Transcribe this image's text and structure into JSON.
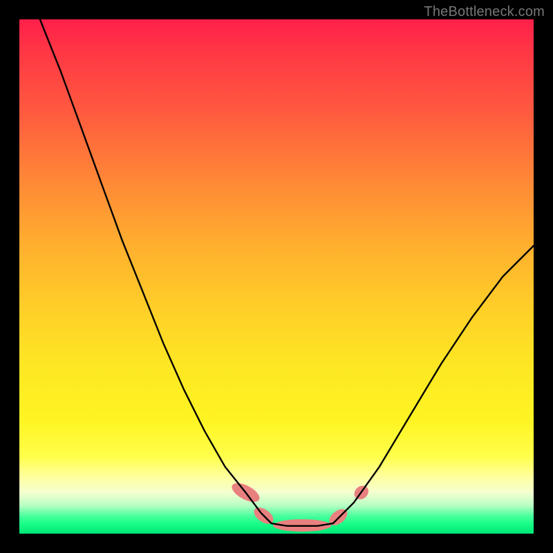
{
  "watermark": "TheBottleneck.com",
  "chart_data": {
    "type": "line",
    "title": "",
    "xlabel": "",
    "ylabel": "",
    "xlim": [
      0,
      100
    ],
    "ylim": [
      0,
      100
    ],
    "series": [
      {
        "name": "left-curve",
        "x": [
          4,
          8,
          12,
          16,
          20,
          24,
          28,
          32,
          36,
          40,
          44,
          47,
          49
        ],
        "y": [
          100,
          90,
          79,
          68,
          57,
          47,
          37,
          28,
          20,
          13,
          8,
          4,
          2
        ]
      },
      {
        "name": "valley-floor",
        "x": [
          49,
          52,
          55,
          58,
          61
        ],
        "y": [
          2,
          1.5,
          1.5,
          1.5,
          2
        ]
      },
      {
        "name": "right-curve",
        "x": [
          61,
          65,
          70,
          76,
          82,
          88,
          94,
          100
        ],
        "y": [
          2,
          6,
          13,
          23,
          33,
          42,
          50,
          56
        ]
      }
    ],
    "markers": [
      {
        "name": "left-cap-upper",
        "x": 44.0,
        "y": 8.0,
        "rx": 10,
        "ry": 22,
        "rot": -62
      },
      {
        "name": "left-cap-lower",
        "x": 47.5,
        "y": 3.5,
        "rx": 9,
        "ry": 16,
        "rot": -55
      },
      {
        "name": "floor-bar",
        "x": 55.0,
        "y": 1.6,
        "rx": 42,
        "ry": 9,
        "rot": 0
      },
      {
        "name": "right-cap-lower",
        "x": 62.0,
        "y": 3.2,
        "rx": 9,
        "ry": 15,
        "rot": 52
      },
      {
        "name": "right-dot",
        "x": 66.5,
        "y": 8.0,
        "rx": 9,
        "ry": 11,
        "rot": 50
      }
    ],
    "marker_color": "#e98080",
    "curve_color": "#000000"
  }
}
